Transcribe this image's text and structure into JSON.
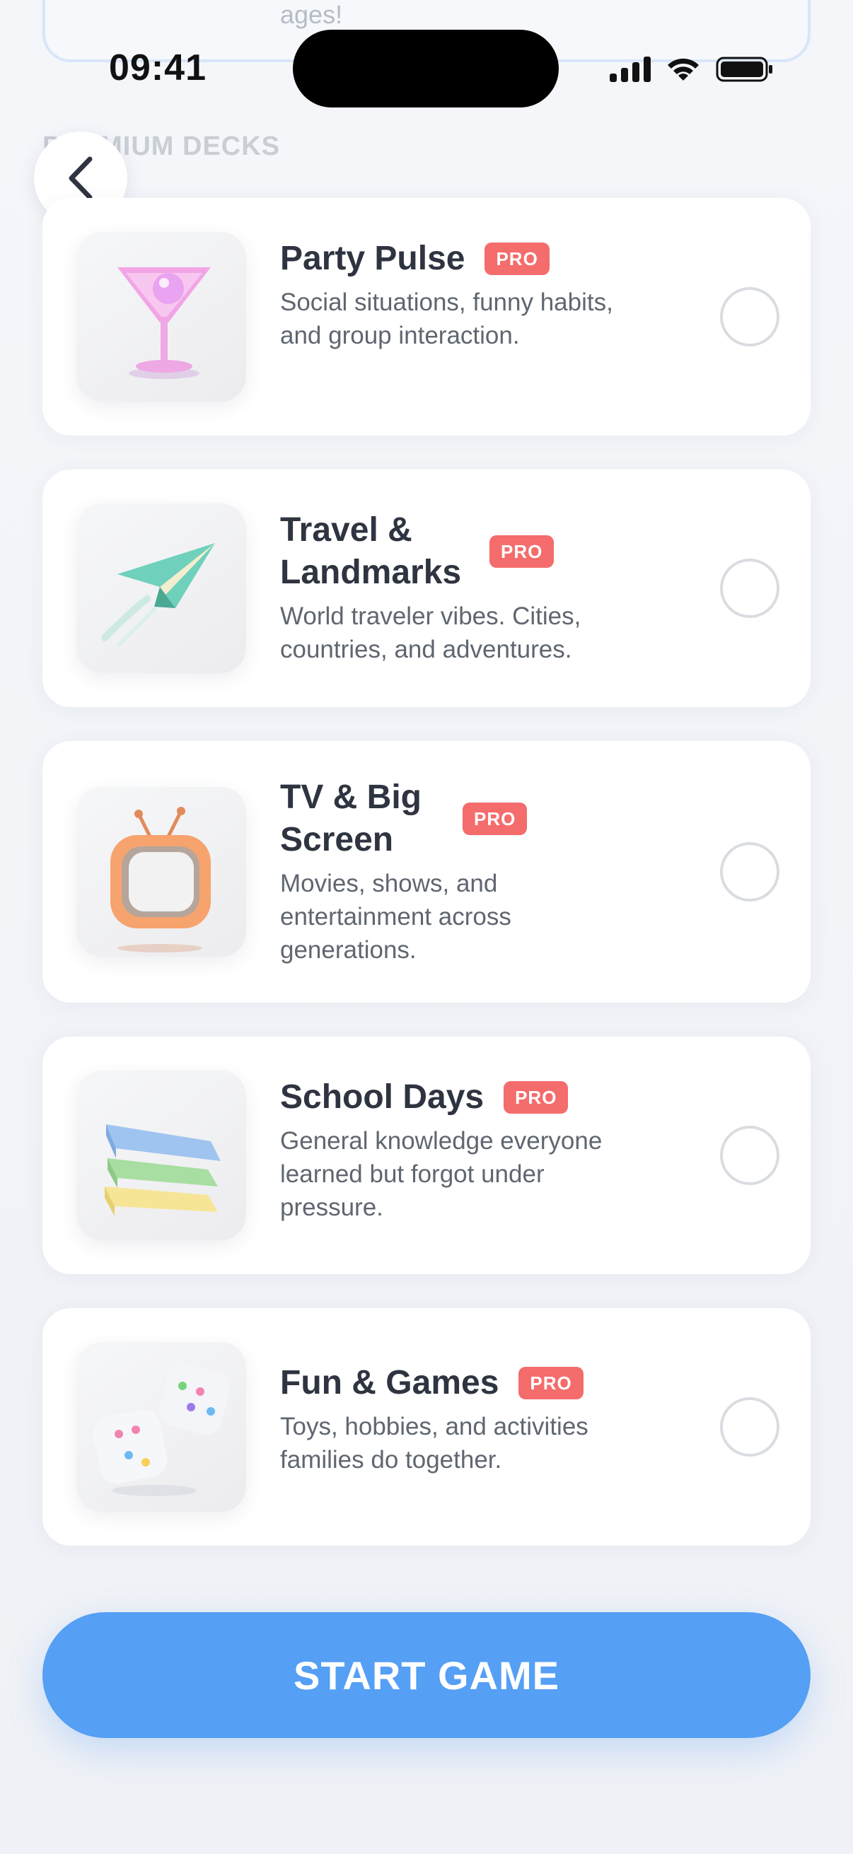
{
  "status_bar": {
    "time": "09:41"
  },
  "previous_card": {
    "text": "ages!"
  },
  "section": {
    "label": "PREMIUM DECKS"
  },
  "icons": {
    "back": "chevron-left-icon",
    "signal": "signal-icon",
    "wifi": "wifi-icon",
    "battery": "battery-icon"
  },
  "decks": [
    {
      "title": "Party Pulse",
      "badge": "PRO",
      "description": "Social situations, funny habits, and group interaction.",
      "icon": "cocktail-glass-icon",
      "selected": false
    },
    {
      "title": "Travel & Landmarks",
      "badge": "PRO",
      "description": "World traveler vibes. Cities, countries, and adventures.",
      "icon": "paper-plane-icon",
      "selected": false
    },
    {
      "title": "TV & Big Screen",
      "badge": "PRO",
      "description": "Movies, shows, and entertainment across generations.",
      "icon": "retro-tv-icon",
      "selected": false
    },
    {
      "title": "School Days",
      "badge": "PRO",
      "description": "General knowledge everyone learned but forgot under pressure.",
      "icon": "books-stack-icon",
      "selected": false
    },
    {
      "title": "Fun & Games",
      "badge": "PRO",
      "description": "Toys, hobbies, and activities families do together.",
      "icon": "dice-icon",
      "selected": false
    }
  ],
  "actions": {
    "start_label": "START GAME"
  },
  "colors": {
    "accent": "#559ff5",
    "pro_badge": "#f46c6c",
    "background": "#f1f3f7"
  }
}
